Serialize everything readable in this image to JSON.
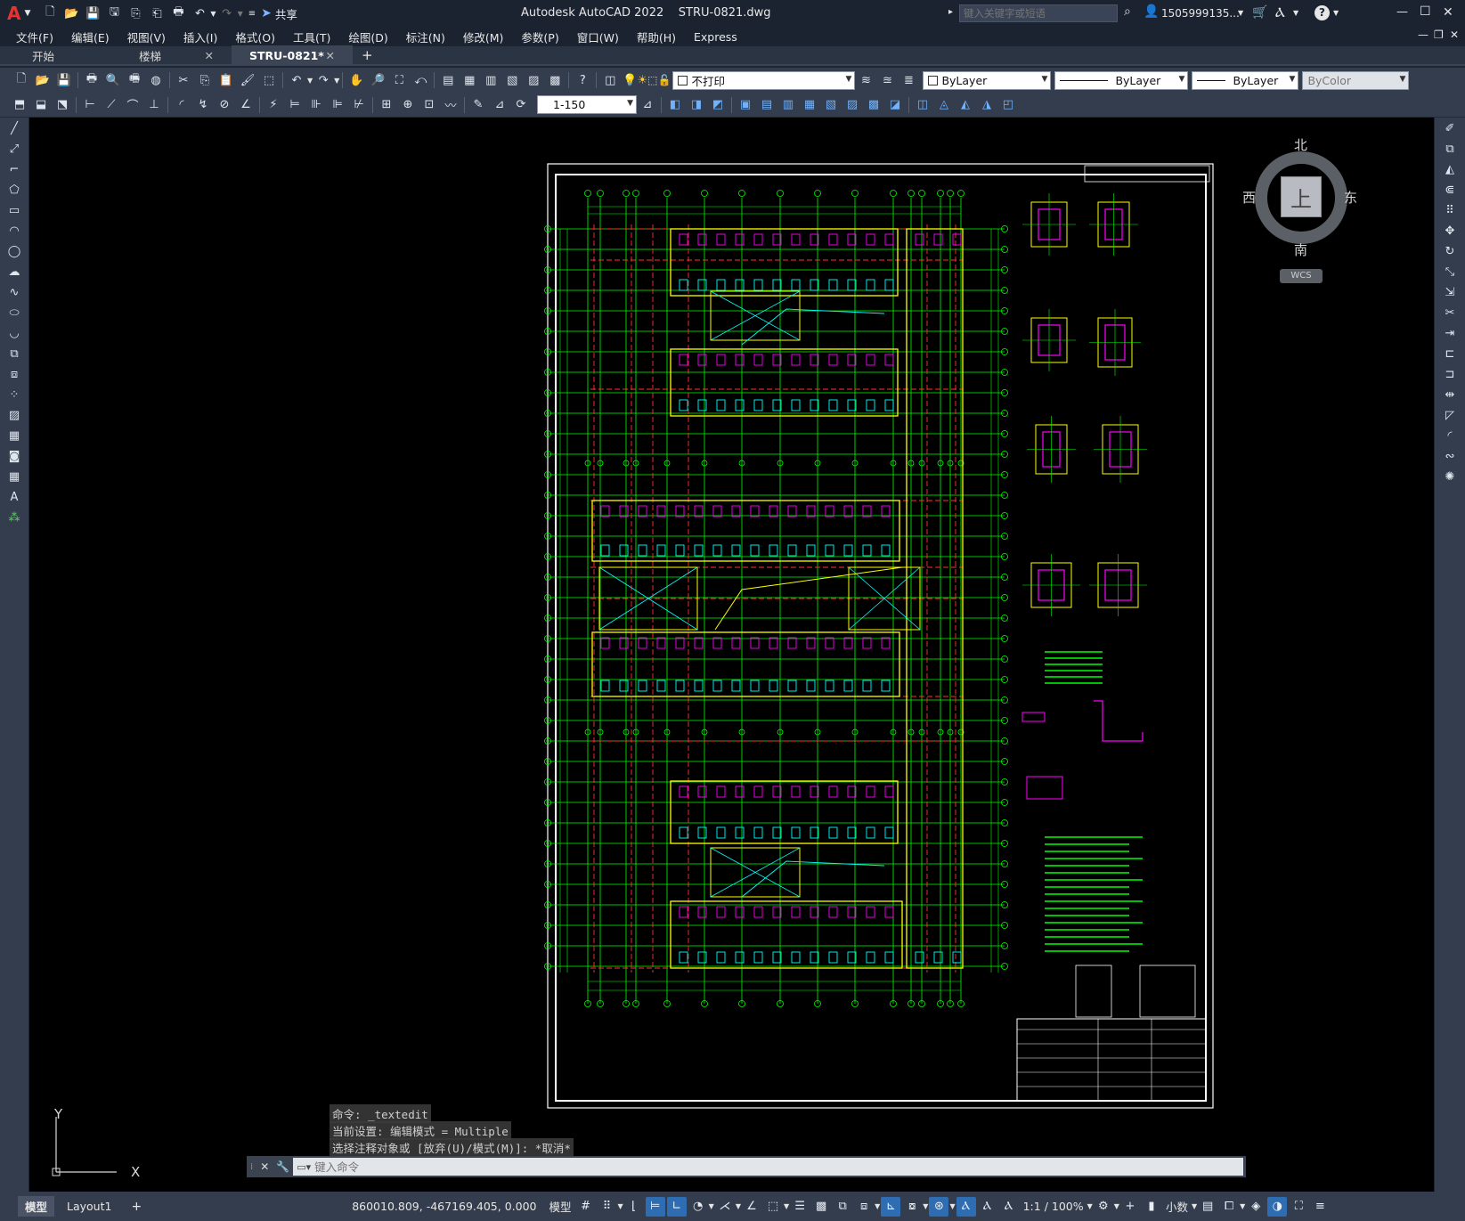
{
  "titlebar": {
    "logo": "A",
    "share_label": "共享",
    "title": "Autodesk AutoCAD 2022    STRU-0821.dwg",
    "search_placeholder": "键入关键字或短语",
    "user": "1505999135...",
    "help": "?",
    "min": "—",
    "max": "☐",
    "close": "✕"
  },
  "menubar": {
    "items": [
      "文件(F)",
      "编辑(E)",
      "视图(V)",
      "插入(I)",
      "格式(O)",
      "工具(T)",
      "绘图(D)",
      "标注(N)",
      "修改(M)",
      "参数(P)",
      "窗口(W)",
      "帮助(H)",
      "Express"
    ]
  },
  "tabs": [
    {
      "label": "开始"
    },
    {
      "label": "楼梯"
    },
    {
      "label": "STRU-0821*"
    }
  ],
  "toolbar": {
    "layer": "不打印",
    "color": "ByLayer",
    "linetype": "ByLayer",
    "lineweight": "ByLayer",
    "plotstyle": "ByColor",
    "scale": "1-150"
  },
  "viewcube": {
    "north": "北",
    "south": "南",
    "east": "东",
    "west": "西",
    "top": "上",
    "wcs": "WCS"
  },
  "ucs": {
    "x": "X",
    "y": "Y"
  },
  "command": {
    "history": [
      "命令: _textedit",
      "当前设置: 编辑模式 = Multiple",
      "选择注释对象或 [放弃(U)/模式(M)]: *取消*"
    ],
    "placeholder": "键入命令"
  },
  "statusbar": {
    "tabs": [
      "模型",
      "Layout1"
    ],
    "add": "+",
    "coords": "860010.809, -467169.405, 0.000",
    "space": "模型",
    "scale": "1:1 / 100%",
    "units": "小数"
  },
  "colors": {
    "grid_green": "#00ff00",
    "cad_yellow": "#ffff00",
    "cad_magenta": "#ff00ff",
    "cad_cyan": "#00ffff",
    "cad_red": "#ff3030",
    "ui_dark": "#343d4d"
  }
}
